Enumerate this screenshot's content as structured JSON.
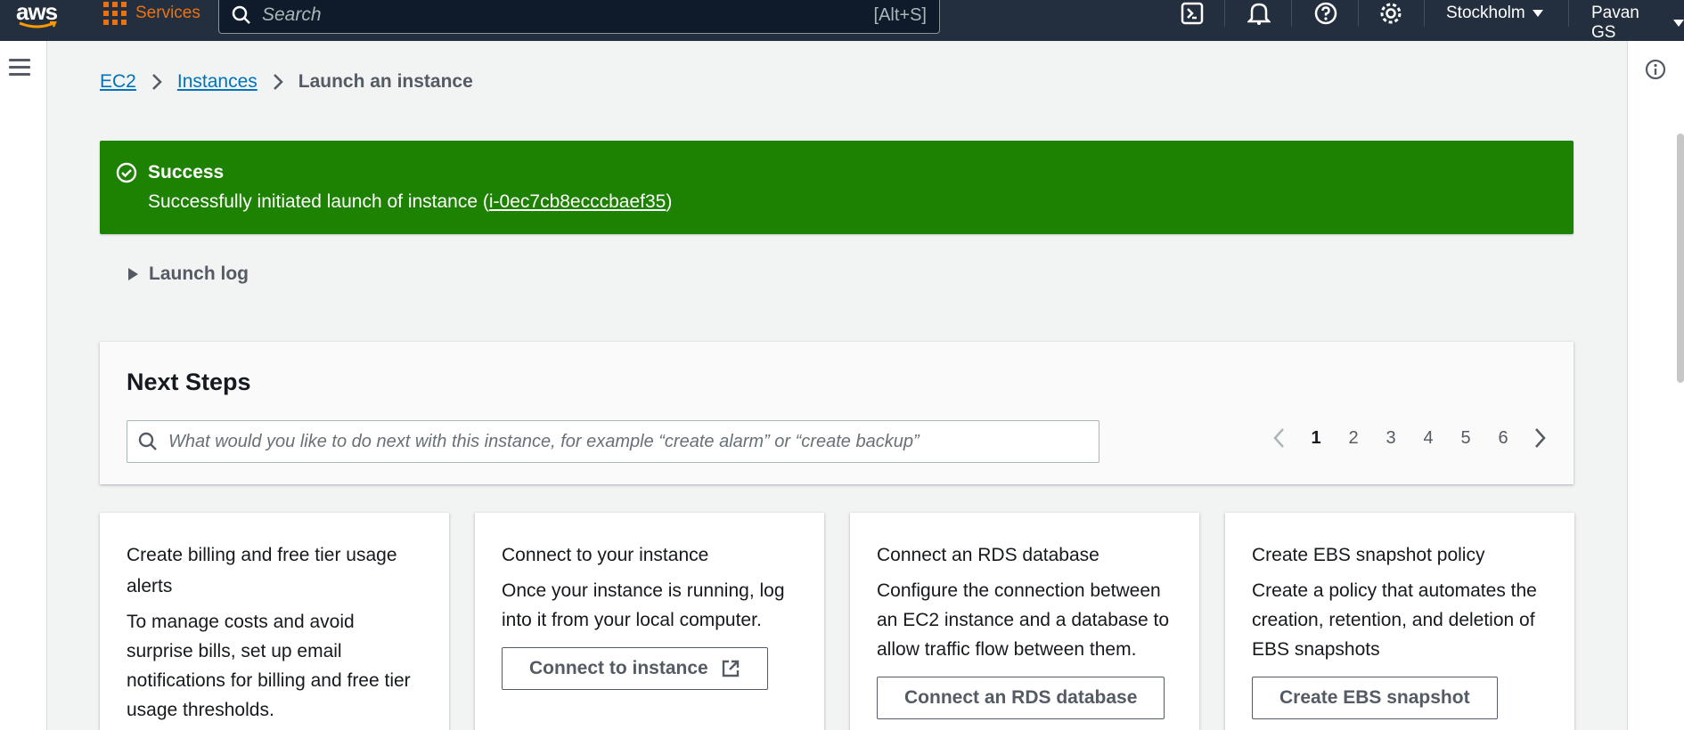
{
  "topnav": {
    "logo_text": "aws",
    "services_label": "Services",
    "search_placeholder": "Search",
    "search_shortcut": "[Alt+S]",
    "region": "Stockholm",
    "user": "Pavan GS"
  },
  "breadcrumb": {
    "items": [
      "EC2",
      "Instances"
    ],
    "current": "Launch an instance"
  },
  "flash": {
    "type": "success",
    "title": "Success",
    "message_prefix": "Successfully initiated launch of instance (",
    "instance_id": "i-0ec7cb8ecccbaef35",
    "message_suffix": ")"
  },
  "launch_log": {
    "label": "Launch log"
  },
  "next_steps": {
    "title": "Next Steps",
    "search_placeholder": "What would you like to do next with this instance, for example “create alarm” or “create backup”",
    "pages": [
      "1",
      "2",
      "3",
      "4",
      "5",
      "6"
    ],
    "current_page": "1"
  },
  "cards": [
    {
      "title": "Create billing and free tier usage alerts",
      "description": "To manage costs and avoid surprise bills, set up email notifications for billing and free tier usage thresholds."
    },
    {
      "title": "Connect to your instance",
      "description": "Once your instance is running, log into it from your local computer.",
      "button": "Connect to instance"
    },
    {
      "title": "Connect an RDS database",
      "description": "Configure the connection between an EC2 instance and a database to allow traffic flow between them.",
      "button": "Connect an RDS database"
    },
    {
      "title": "Create EBS snapshot policy",
      "description": "Create a policy that automates the creation, retention, and deletion of EBS snapshots",
      "button": "Create EBS snapshot"
    }
  ],
  "colors": {
    "nav_bg": "#232f3e",
    "accent_orange": "#ec7211",
    "success_green": "#1d8102",
    "link_blue": "#0073bb"
  }
}
